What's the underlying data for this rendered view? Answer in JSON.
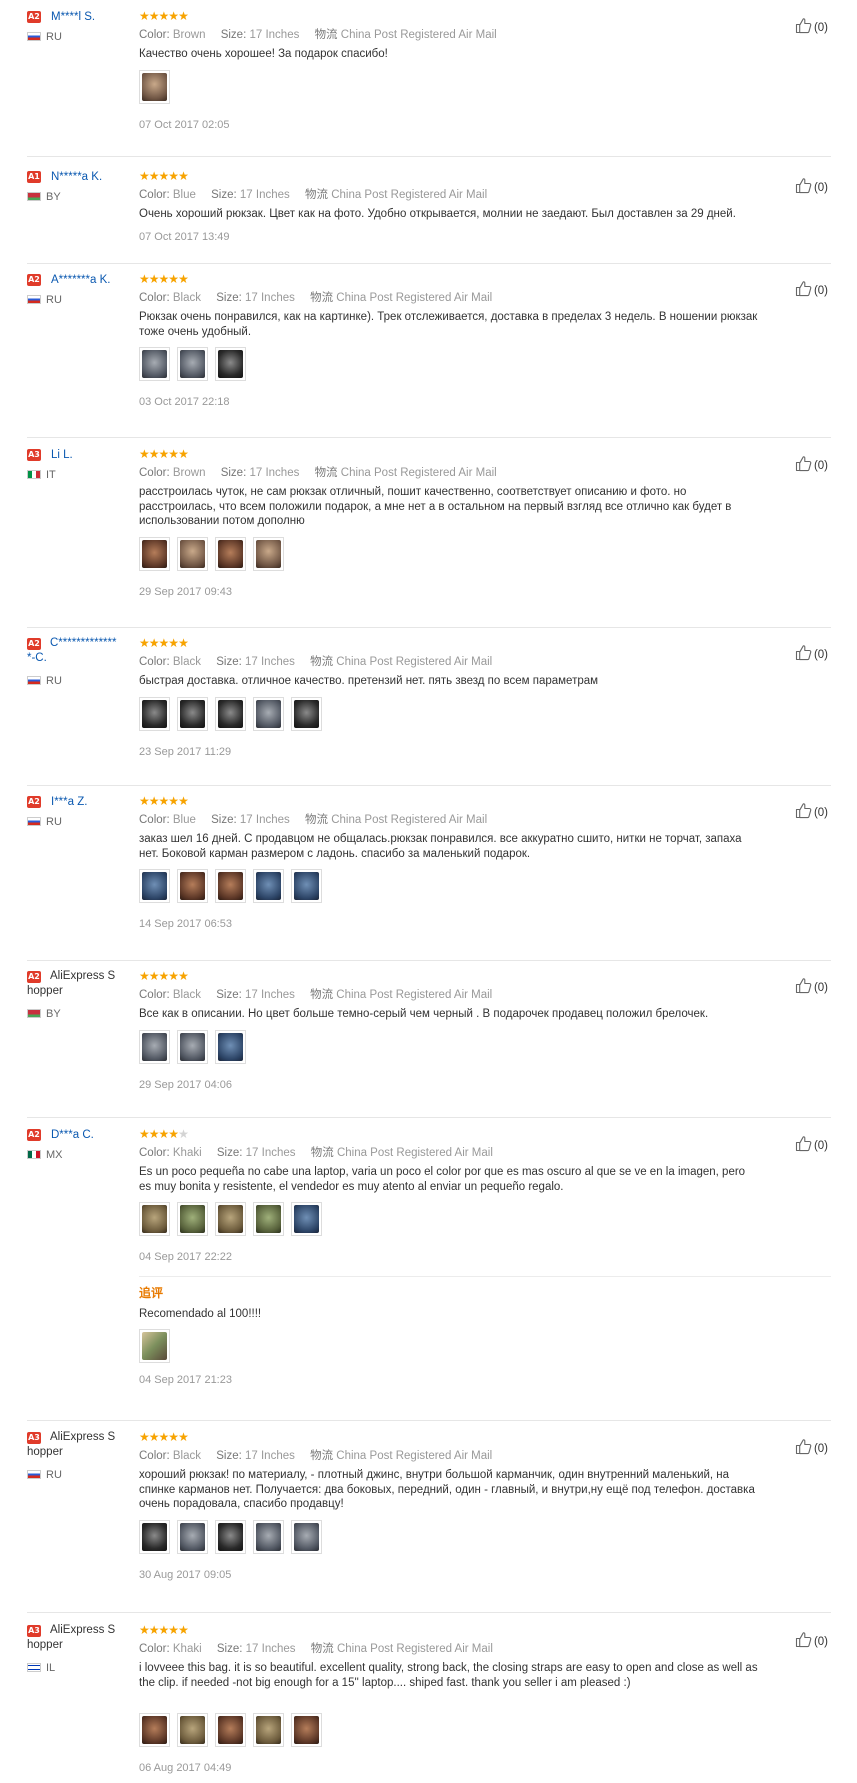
{
  "labels": {
    "color": "Color:",
    "size": "Size:",
    "logistics": "物流",
    "additional_feedback": "追评"
  },
  "star_color": "#f7a300",
  "reviews": [
    {
      "level": "A2",
      "name": "M****l S.",
      "country": "RU",
      "stars": 5,
      "color": "Brown",
      "size": "17 Inches",
      "shipping": "China Post Registered Air Mail",
      "text": "Качество очень хорошее! За подарок спасибо!",
      "photos": [
        "c-brown"
      ],
      "date": "07 Oct 2017 02:05",
      "helpful": "(0)"
    },
    {
      "level": "A1",
      "name": "N*****a K.",
      "country": "BY",
      "stars": 5,
      "color": "Blue",
      "size": "17 Inches",
      "shipping": "China Post Registered Air Mail",
      "text": "Очень хороший рюкзак. Цвет как на фото. Удобно открывается, молнии не заедают. Был доставлен за 29 дней.",
      "photos": [],
      "date": "07 Oct 2017 13:49",
      "helpful": "(0)"
    },
    {
      "level": "A2",
      "name": "A*******a K.",
      "country": "RU",
      "stars": 5,
      "color": "Black",
      "size": "17 Inches",
      "shipping": "China Post Registered Air Mail",
      "text": "Рюкзак очень понравился, как на картинке). Трек отслеживается, доставка в пределах 3 недель. В ношении рюкзак тоже очень удобный.",
      "photos": [
        "c-grey",
        "c-grey",
        "c-black"
      ],
      "date": "03 Oct 2017 22:18",
      "helpful": "(0)"
    },
    {
      "level": "A3",
      "name": "Li L.",
      "country": "IT",
      "stars": 5,
      "color": "Brown",
      "size": "17 Inches",
      "shipping": "China Post Registered Air Mail",
      "text": "расстроилась чуток, не сам рюкзак отличный, пошит качественно, соответствует описанию и фото. но расстроилась, что всем положили подарок, а мне нет а в остальном на первый взгляд все отлично как будет в использовании потом дополню",
      "photos": [
        "c-brown2",
        "c-brown",
        "c-brown2",
        "c-brown"
      ],
      "date": "29 Sep 2017 09:43",
      "helpful": "(0)"
    },
    {
      "level": "A2",
      "name": "C**************-C.",
      "country": "RU",
      "stars": 5,
      "color": "Black",
      "size": "17 Inches",
      "shipping": "China Post Registered Air Mail",
      "text": "быстрая доставка. отличное качество. претензий нет. пять звезд по всем параметрам",
      "photos": [
        "c-black",
        "c-black",
        "c-black",
        "c-grey",
        "c-black"
      ],
      "date": "23 Sep 2017 11:29",
      "helpful": "(0)"
    },
    {
      "level": "A2",
      "name": "I***a Z.",
      "country": "RU",
      "stars": 5,
      "color": "Blue",
      "size": "17 Inches",
      "shipping": "China Post Registered Air Mail",
      "text": "заказ шел 16 дней. С продавцом не общалась.рюкзак понравился. все аккуратно сшито, нитки не торчат, запаха нет. Боковой карман размером с ладонь. спасибо за маленький подарок.",
      "photos": [
        "c-blue",
        "c-brown2",
        "c-brown2",
        "c-blue",
        "c-blue"
      ],
      "date": "14 Sep 2017 06:53",
      "helpful": "(0)"
    },
    {
      "level": "A2",
      "name": "AliExpress Shopper",
      "country": "BY",
      "stars": 5,
      "color": "Black",
      "size": "17 Inches",
      "shipping": "China Post Registered Air Mail",
      "text": "Все как в описании. Но цвет больше темно-серый чем черный . В подарочек продавец положил брелочек.",
      "photos": [
        "c-grey",
        "c-grey",
        "c-blue"
      ],
      "date": "29 Sep 2017 04:06",
      "helpful": "(0)"
    },
    {
      "level": "A2",
      "name": "D***a C.",
      "country": "MX",
      "stars": 4,
      "color": "Khaki",
      "size": "17 Inches",
      "shipping": "China Post Registered Air Mail",
      "text": "Es un poco pequeña no cabe una laptop, varia un poco el color por que es mas oscuro al que se ve en la imagen, pero es muy bonita y resistente, el vendedor es muy atento al enviar un pequeño regalo.",
      "photos": [
        "c-khaki",
        "c-green",
        "c-khaki",
        "c-green",
        "c-blue"
      ],
      "date": "04 Sep 2017 22:22",
      "helpful": "(0)",
      "additional": {
        "text": "Recomendado al 100!!!!",
        "photos": [
          "c-photo"
        ],
        "date": "04 Sep 2017 21:23"
      }
    },
    {
      "level": "A3",
      "name": "AliExpress Shopper",
      "country": "RU",
      "stars": 5,
      "color": "Black",
      "size": "17 Inches",
      "shipping": "China Post Registered Air Mail",
      "text": "хороший рюкзак! по материалу, - плотный джинс, внутри большой карманчик, один внутренний маленький, на спинке карманов нет. Получается: два боковых, передний, один - главный, и внутри,ну ещё под телефон. доставка очень порадовала, спасибо продавцу!",
      "photos": [
        "c-black",
        "c-grey",
        "c-black",
        "c-grey",
        "c-grey"
      ],
      "date": "30 Aug 2017 09:05",
      "helpful": "(0)"
    },
    {
      "level": "A3",
      "name": "AliExpress Shopper",
      "country": "IL",
      "stars": 5,
      "color": "Khaki",
      "size": "17 Inches",
      "shipping": "China Post Registered Air Mail",
      "text": "i lovveee this bag. it is so beautiful. excellent quality, strong back, the closing straps are easy to open and close as well as the clip. if needed -not big enough for a 15'' laptop.... shiped fast. thank you seller i am pleased :)",
      "photos": [
        "c-brown2",
        "c-khaki",
        "c-brown2",
        "c-khaki",
        "c-brown2"
      ],
      "date": "06 Aug 2017 04:49",
      "helpful": "(0)"
    }
  ]
}
